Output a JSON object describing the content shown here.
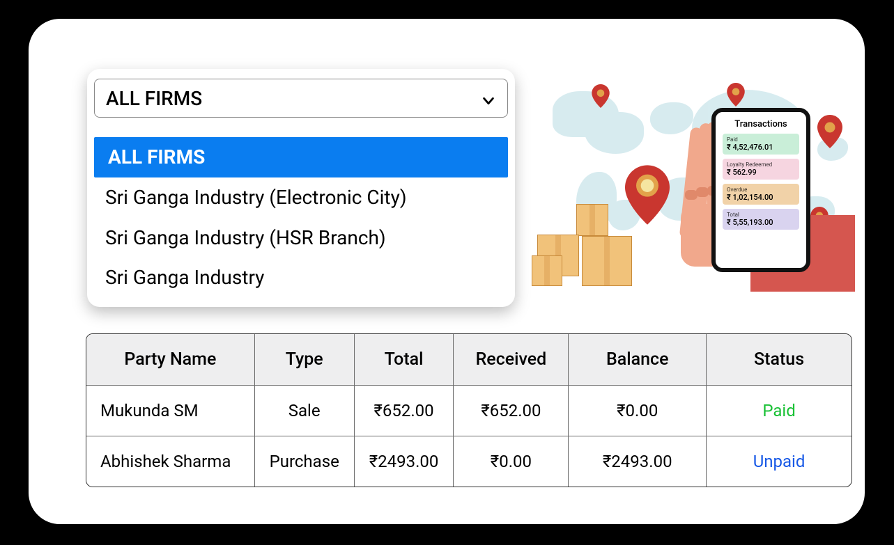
{
  "dropdown": {
    "selected_label": "ALL FIRMS",
    "options": [
      "ALL FIRMS",
      "Sri Ganga Industry (Electronic City)",
      "Sri Ganga Industry (HSR Branch)",
      "Sri Ganga Industry"
    ]
  },
  "phone": {
    "title": "Transactions",
    "rows": [
      {
        "label": "Paid",
        "value": "₹ 4,52,476.01"
      },
      {
        "label": "Loyalty Redeemed",
        "value": "₹ 562.99"
      },
      {
        "label": "Overdue",
        "value": "₹ 1,02,154.00"
      },
      {
        "label": "Total",
        "value": "₹ 5,55,193.00"
      }
    ]
  },
  "table": {
    "headers": [
      "Party Name",
      "Type",
      "Total",
      "Received",
      "Balance",
      "Status"
    ],
    "rows": [
      {
        "party": "Mukunda SM",
        "type": "Sale",
        "total": "₹652.00",
        "received": "₹652.00",
        "balance": "₹0.00",
        "status": "Paid",
        "status_class": "paid"
      },
      {
        "party": "Abhishek Sharma",
        "type": "Purchase",
        "total": "₹2493.00",
        "received": "₹0.00",
        "balance": "₹2493.00",
        "status": "Unpaid",
        "status_class": "unpaid"
      }
    ]
  }
}
